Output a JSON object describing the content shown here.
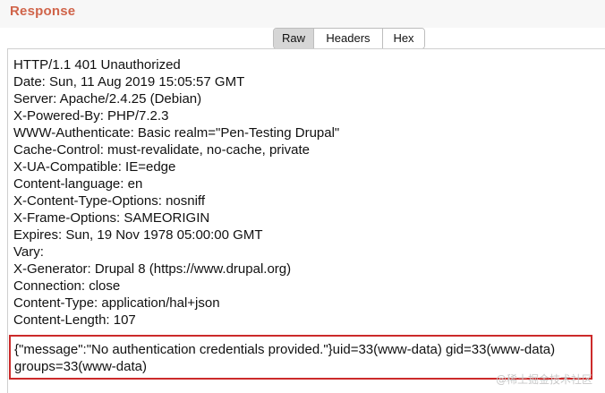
{
  "panel": {
    "title": "Response"
  },
  "tabs": [
    {
      "label": "Raw",
      "active": true
    },
    {
      "label": "Headers",
      "active": false
    },
    {
      "label": "Hex",
      "active": false
    }
  ],
  "response": {
    "header_lines": [
      "HTTP/1.1 401 Unauthorized",
      "Date: Sun, 11 Aug 2019 15:05:57 GMT",
      "Server: Apache/2.4.25 (Debian)",
      "X-Powered-By: PHP/7.2.3",
      "WWW-Authenticate: Basic realm=\"Pen-Testing Drupal\"",
      "Cache-Control: must-revalidate, no-cache, private",
      "X-UA-Compatible: IE=edge",
      "Content-language: en",
      "X-Content-Type-Options: nosniff",
      "X-Frame-Options: SAMEORIGIN",
      "Expires: Sun, 19 Nov 1978 05:00:00 GMT",
      "Vary:",
      "X-Generator: Drupal 8 (https://www.drupal.org)",
      "Connection: close",
      "Content-Type: application/hal+json",
      "Content-Length: 107"
    ],
    "body_lines": [
      "{\"message\":\"No authentication credentials provided.\"}uid=33(www-data) gid=33(www-data)",
      "groups=33(www-data)"
    ]
  },
  "watermark": "@稀土掘金技术社区",
  "colors": {
    "title": "#d0644a",
    "highlight_border": "#cc2a2a",
    "active_tab": "#d6d6d6"
  }
}
